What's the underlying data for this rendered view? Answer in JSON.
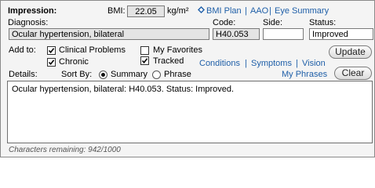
{
  "header": {
    "title": "Impression:",
    "bmi_label": "BMI:",
    "bmi_value": "22.05",
    "bmi_unit": "kg/m²",
    "bmi_plan_label": "BMI Plan",
    "aao_label": "AAO",
    "eye_summary_label": "Eye Summary",
    "separator": "|"
  },
  "diagnosis": {
    "label": "Diagnosis:",
    "value": "Ocular hypertension, bilateral",
    "code_label": "Code:",
    "code_value": "H40.053",
    "side_label": "Side:",
    "side_value": "",
    "status_label": "Status:",
    "status_value": "Improved"
  },
  "add_to": {
    "label": "Add to:",
    "clinical_problems": {
      "label": "Clinical Problems",
      "checked": true
    },
    "my_favorites": {
      "label": "My Favorites",
      "checked": false
    },
    "chronic": {
      "label": "Chronic",
      "checked": true
    },
    "tracked": {
      "label": "Tracked",
      "checked": true
    }
  },
  "links": {
    "conditions": "Conditions",
    "symptoms": "Symptoms",
    "vision": "Vision",
    "my_phrases": "My Phrases"
  },
  "buttons": {
    "update": "Update",
    "clear": "Clear"
  },
  "details": {
    "label": "Details:",
    "sort_by_label": "Sort By:",
    "summary_label": "Summary",
    "phrase_label": "Phrase",
    "selected_sort": "Summary",
    "text": "Ocular hypertension, bilateral: H40.053. Status: Improved."
  },
  "footer": {
    "characters_remaining": "Characters remaining: 942/1000"
  },
  "colors": {
    "link": "#1f5fa8",
    "panel_bg": "#f4f4f4"
  },
  "icons": {
    "bmi_plan": "diamond-icon",
    "checkbox": "checkmark-icon"
  }
}
